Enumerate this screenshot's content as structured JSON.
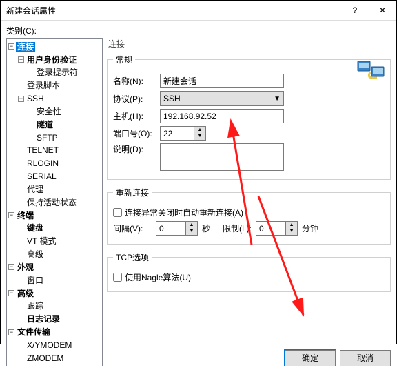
{
  "window": {
    "title": "新建会话属性",
    "help_icon": "?",
    "close_icon": "✕"
  },
  "category_label": "类别(C):",
  "tree": {
    "connection": "连接",
    "auth_folder": "用户身份验证",
    "login_prompt": "登录提示符",
    "login_script": "登录脚本",
    "ssh_folder": "SSH",
    "security": "安全性",
    "tunnel": "隧道",
    "sftp": "SFTP",
    "telnet": "TELNET",
    "rlogin": "RLOGIN",
    "serial": "SERIAL",
    "proxy": "代理",
    "keep_alive": "保持活动状态",
    "terminal": "终端",
    "keyboard": "键盘",
    "vt": "VT 模式",
    "advanced": "高级",
    "appearance": "外观",
    "window": "窗口",
    "adv_group": "高级",
    "tracking": "跟踪",
    "logging": "日志记录",
    "file_transfer": "文件传输",
    "xymodem": "X/YMODEM",
    "zmodem": "ZMODEM"
  },
  "section_title": "连接",
  "general": {
    "legend": "常规",
    "name_label": "名称(N):",
    "name_value": "新建会话",
    "protocol_label": "协议(P):",
    "protocol_value": "SSH",
    "host_label": "主机(H):",
    "host_value": "192.168.92.52",
    "port_label": "端口号(O):",
    "port_value": "22",
    "desc_label": "说明(D):",
    "desc_value": ""
  },
  "reconnect": {
    "legend": "重新连接",
    "auto_label": "连接异常关闭时自动重新连接(A)",
    "interval_label": "间隔(V):",
    "interval_value": "0",
    "seconds": "秒",
    "limit_label": "限制(L):",
    "limit_value": "0",
    "minutes": "分钟"
  },
  "tcp": {
    "legend": "TCP选项",
    "nagle_label": "使用Nagle算法(U)"
  },
  "ok_label": "确定",
  "cancel_label": "取消"
}
